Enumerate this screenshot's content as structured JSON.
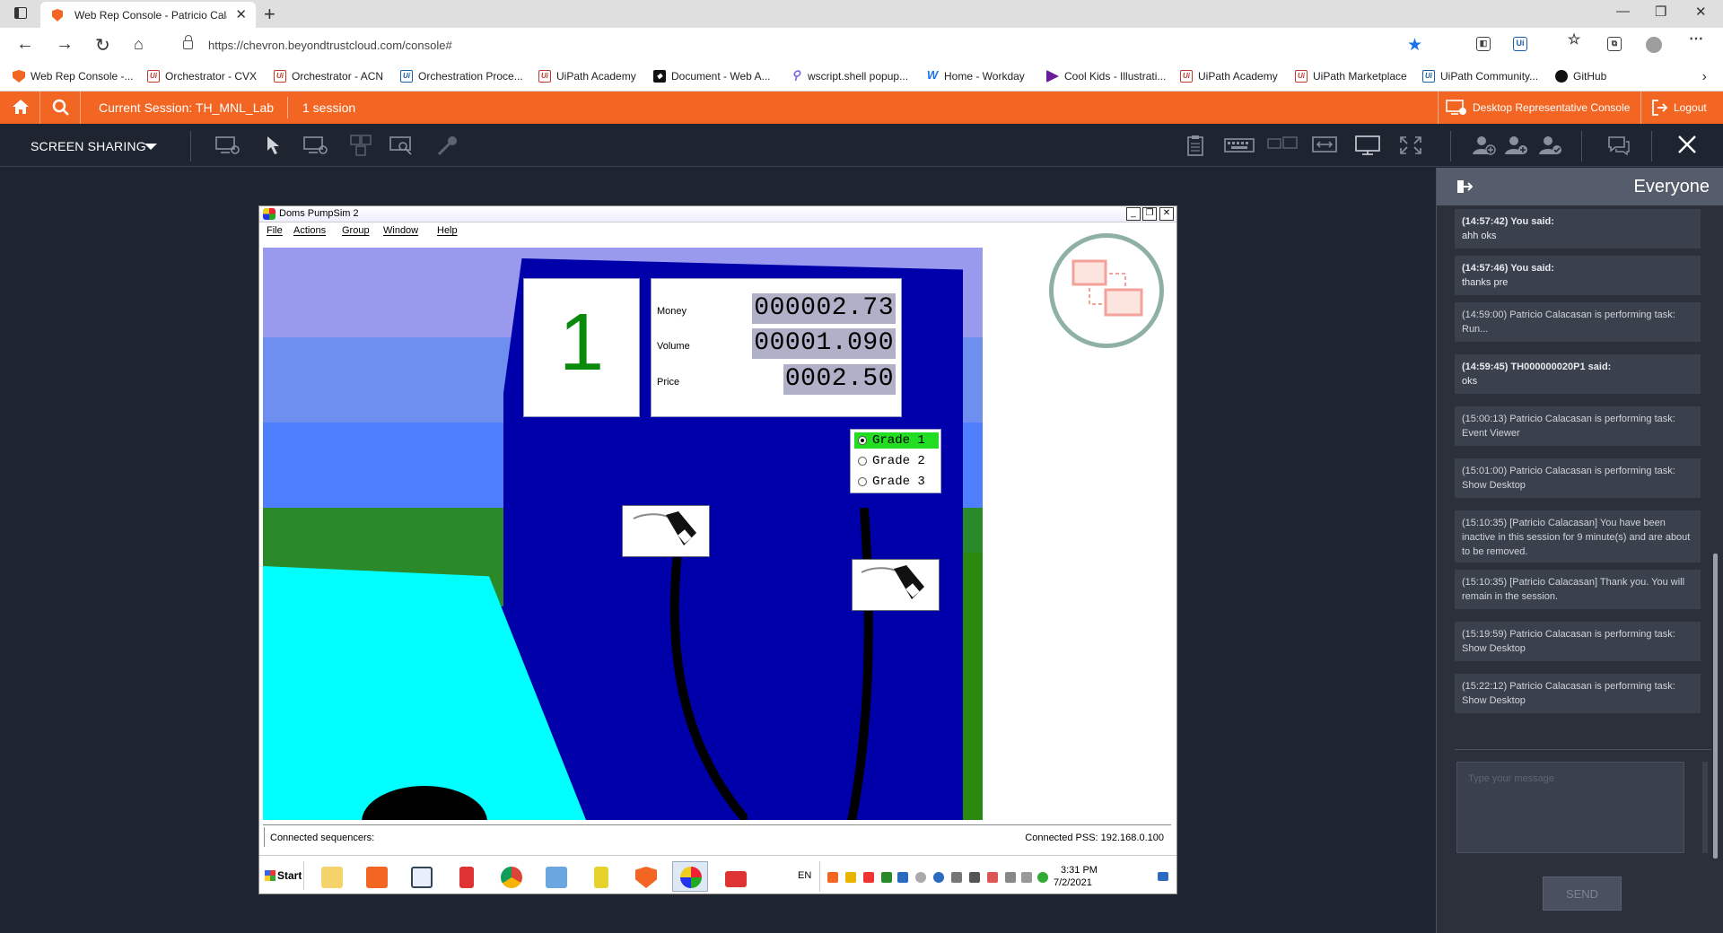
{
  "browser": {
    "tab_title": "Web Rep Console - Patricio Calacasan",
    "url": "https://chevron.beyondtrustcloud.com/console#",
    "bookmarks": [
      {
        "label": "Web Rep Console -...",
        "icon": "beyondtrust-shield-icon"
      },
      {
        "label": "Orchestrator - CVX",
        "icon": "uipath-icon"
      },
      {
        "label": "Orchestrator - ACN",
        "icon": "uipath-icon"
      },
      {
        "label": "Orchestration Proce...",
        "icon": "uipath-blue-icon"
      },
      {
        "label": "UiPath Academy",
        "icon": "uipath-icon"
      },
      {
        "label": "Document - Web A...",
        "icon": "document-icon"
      },
      {
        "label": "wscript.shell popup...",
        "icon": "pin-icon"
      },
      {
        "label": "Home - Workday",
        "icon": "workday-icon"
      },
      {
        "label": "Cool Kids - Illustrati...",
        "icon": "cool-kids-icon"
      },
      {
        "label": "UiPath Academy",
        "icon": "uipath-icon"
      },
      {
        "label": "UiPath Marketplace",
        "icon": "uipath-icon"
      },
      {
        "label": "UiPath Community...",
        "icon": "uipath-blue-icon"
      },
      {
        "label": "GitHub",
        "icon": "github-icon"
      }
    ]
  },
  "session_bar": {
    "current_session": "Current Session: TH_MNL_Lab",
    "session_count": "1 session",
    "desktop_console": "Desktop Representative Console",
    "logout": "Logout",
    "accent": "#f26522"
  },
  "toolbar": {
    "screen_sharing": "SCREEN SHARING"
  },
  "remote": {
    "title": "Doms PumpSim 2",
    "menu": [
      "File",
      "Actions",
      "Group",
      "Window",
      "Help"
    ],
    "pump_number": "1",
    "money_label": "Money",
    "money_value": "000002.73",
    "volume_label": "Volume",
    "volume_value": "00001.090",
    "price_label": "Price",
    "price_value": "0002.50",
    "grades": [
      {
        "label": "Grade 1",
        "selected": true
      },
      {
        "label": "Grade 2",
        "selected": false
      },
      {
        "label": "Grade 3",
        "selected": false
      }
    ],
    "status_left": "Connected sequencers:",
    "status_right": "Connected PSS: 192.168.0.100",
    "start": "Start",
    "lang": "EN",
    "time": "3:31 PM",
    "date": "7/2/2021"
  },
  "chat": {
    "title": "Everyone",
    "messages": [
      {
        "who": "(14:57:42) You said:",
        "text": "ahh oks",
        "bold": true
      },
      {
        "who": "(14:57:46) You said:",
        "text": "thanks pre",
        "bold": true
      },
      {
        "who": "",
        "text": "(14:59:00) Patricio Calacasan is performing task: Run...",
        "bold": false
      },
      {
        "who": "(14:59:45) TH000000020P1 said:",
        "text": "oks",
        "bold": true
      },
      {
        "who": "",
        "text": "(15:00:13) Patricio Calacasan is performing task: Event Viewer",
        "bold": false
      },
      {
        "who": "",
        "text": "(15:01:00) Patricio Calacasan is performing task: Show Desktop",
        "bold": false
      },
      {
        "who": "",
        "text": "(15:10:35) [Patricio Calacasan] You have been inactive in this session for 9 minute(s) and are about to be removed.",
        "bold": false
      },
      {
        "who": "",
        "text": "(15:10:35) [Patricio Calacasan] Thank you. You will remain in the session.",
        "bold": false
      },
      {
        "who": "",
        "text": "(15:19:59) Patricio Calacasan is performing task: Show Desktop",
        "bold": false
      },
      {
        "who": "",
        "text": "(15:22:12) Patricio Calacasan is performing task: Show Desktop",
        "bold": false
      }
    ],
    "input_placeholder": "Type your message",
    "send": "SEND"
  }
}
